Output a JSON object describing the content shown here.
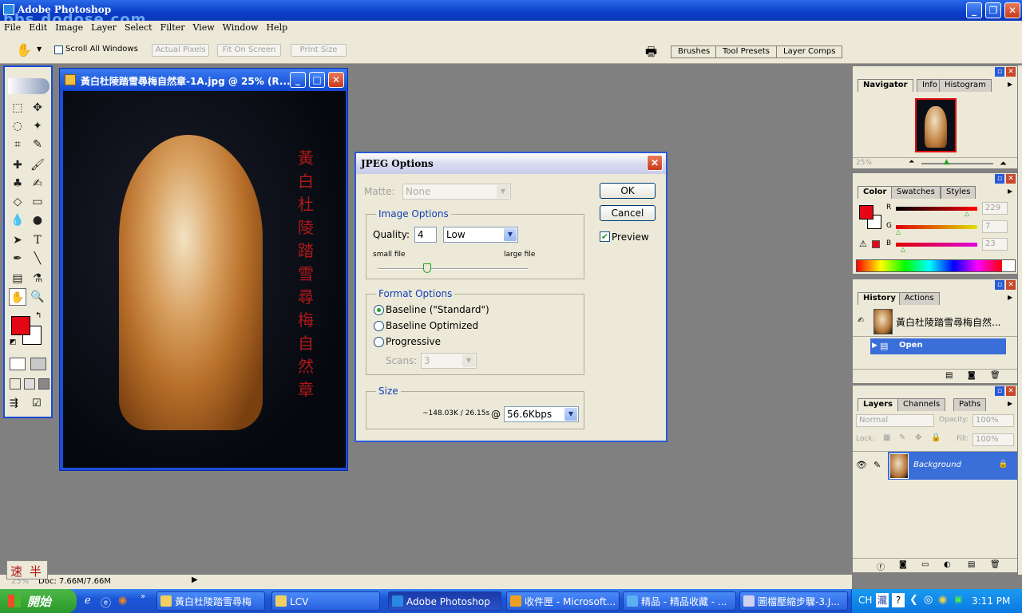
{
  "app": {
    "title": "Adobe Photoshop",
    "watermark": "bbs.dodose.com"
  },
  "menu": [
    "File",
    "Edit",
    "Image",
    "Layer",
    "Select",
    "Filter",
    "View",
    "Window",
    "Help"
  ],
  "options_bar": {
    "scroll_all_windows": "Scroll All Windows",
    "actual_pixels": "Actual Pixels",
    "fit_on_screen": "Fit On Screen",
    "print_size": "Print Size",
    "palette_tabs": [
      "Brushes",
      "Tool Presets",
      "Layer Comps"
    ]
  },
  "document": {
    "title": "黃白杜陵踏雪尋梅自然章-1A.jpg @ 25% (R...",
    "vertical_text": [
      "黃",
      "白",
      "杜",
      "陵",
      "踏",
      "雪",
      "尋",
      "梅",
      "自",
      "然",
      "章"
    ]
  },
  "jpeg_dialog": {
    "title": "JPEG Options",
    "matte_label": "Matte:",
    "matte_value": "None",
    "image_options_legend": "Image Options",
    "quality_label": "Quality:",
    "quality_value": "4",
    "quality_preset": "Low",
    "quality_slider": 0.33,
    "small_file": "small file",
    "large_file": "large file",
    "format_options_legend": "Format Options",
    "format_baseline_standard": "Baseline (\"Standard\")",
    "format_baseline_optimized": "Baseline Optimized",
    "format_progressive": "Progressive",
    "scans_label": "Scans:",
    "scans_value": "3",
    "size_legend": "Size",
    "size_value": "~148.03K / 26.15s",
    "at_label": "@",
    "speed_value": "56.6Kbps",
    "ok": "OK",
    "cancel": "Cancel",
    "preview": "Preview"
  },
  "navigator": {
    "tabs": [
      "Navigator",
      "Info",
      "Histogram"
    ],
    "zoom": "25%"
  },
  "color": {
    "tabs": [
      "Color",
      "Swatches",
      "Styles"
    ],
    "r_label": "R",
    "r_value": "229",
    "g_label": "G",
    "g_value": "7",
    "b_label": "B",
    "b_value": "23",
    "foreground": "#e50717"
  },
  "history": {
    "tabs": [
      "History",
      "Actions"
    ],
    "snapshot": "黃白杜陵踏雪尋梅自然...",
    "step": "Open"
  },
  "layers": {
    "tabs": [
      "Layers",
      "Channels",
      "Paths"
    ],
    "blend_mode": "Normal",
    "opacity_label": "Opacity:",
    "opacity_value": "100%",
    "lock_label": "Lock:",
    "fill_label": "Fill:",
    "fill_value": "100%",
    "layer_name": "Background"
  },
  "status": {
    "doc": "Doc: 7.66M/7.66M",
    "zoom": "25%",
    "ime_1": "速",
    "ime_2": "半"
  },
  "taskbar": {
    "start": "開始",
    "tasks": [
      "黃白杜陵踏雪尋梅",
      "LCV",
      "Adobe Photoshop",
      "收件匣 - Microsoft...",
      "精品 - 精品收藏 - ...",
      "圖檔壓縮步驟-3.J..."
    ],
    "lang": "CH",
    "ime": "瀧",
    "time": "3:11 PM"
  }
}
